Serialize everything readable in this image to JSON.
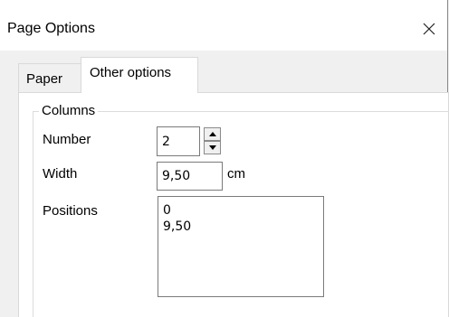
{
  "dialog": {
    "title": "Page Options",
    "close_icon": "close-icon"
  },
  "tabs": [
    {
      "label": "Paper",
      "active": false
    },
    {
      "label": "Other options",
      "active": true
    }
  ],
  "columns_group": {
    "title": "Columns",
    "number": {
      "label": "Number",
      "value": "2",
      "spin_up_icon": "arrow-up-icon",
      "spin_down_icon": "arrow-down-icon"
    },
    "width": {
      "label": "Width",
      "value": "9,50",
      "unit": "cm"
    },
    "positions": {
      "label": "Positions",
      "value": "0\n9,50"
    }
  }
}
